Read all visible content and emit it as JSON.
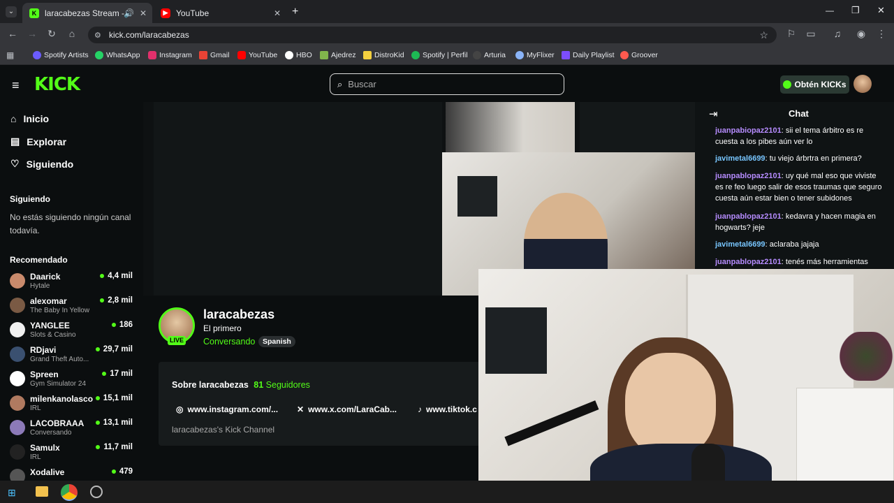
{
  "browser": {
    "tabs": [
      {
        "title": "laracabezas Stream - Watch",
        "active": true
      },
      {
        "title": "YouTube",
        "active": false
      }
    ],
    "url": "kick.com/laracabezas",
    "bookmarks": [
      "Spotify Artists",
      "WhatsApp",
      "Instagram",
      "Gmail",
      "YouTube",
      "HBO",
      "Ajedrez",
      "DistroKid",
      "Spotify | Perfil",
      "Arturia",
      "MyFlixer",
      "Daily Playlist",
      "Groover"
    ]
  },
  "kick": {
    "search_placeholder": "Buscar",
    "get_kicks": "Obtén KICKs",
    "nav": [
      "Inicio",
      "Explorar",
      "Siguiendo"
    ],
    "following_title": "Siguiendo",
    "following_empty": "No estás siguiendo ningún canal todavía.",
    "recommended_title": "Recomendado",
    "recommended": [
      {
        "name": "Daarick",
        "category": "Hytale",
        "viewers": "4,4 mil"
      },
      {
        "name": "alexomar",
        "category": "The Baby In Yellow",
        "viewers": "2,8 mil"
      },
      {
        "name": "YANGLEE",
        "category": "Slots & Casino",
        "viewers": "186"
      },
      {
        "name": "RDjavi",
        "category": "Grand Theft Auto...",
        "viewers": "29,7 mil"
      },
      {
        "name": "Spreen",
        "category": "Gym Simulator 24",
        "viewers": "17 mil"
      },
      {
        "name": "milenkanolasco",
        "category": "IRL",
        "viewers": "15,1 mil"
      },
      {
        "name": "LACOBRAAA",
        "category": "Conversando",
        "viewers": "13,1 mil"
      },
      {
        "name": "Samulx",
        "category": "IRL",
        "viewers": "11,7 mil"
      },
      {
        "name": "Xodalive",
        "category": "",
        "viewers": "479"
      }
    ],
    "channel": {
      "name": "laracabezas",
      "title": "El primero",
      "category": "Conversando",
      "language": "Spanish",
      "live": "LIVE",
      "about_label": "Sobre laracabezas",
      "followers_count": "81",
      "followers_label": "Seguidores",
      "links": [
        "www.instagram.com/...",
        "www.x.com/LaraCab...",
        "www.tiktok.c"
      ],
      "description": "laracabezas's Kick Channel"
    },
    "chat": {
      "title": "Chat",
      "messages": [
        {
          "user": "juanpabiopaz2101",
          "text": "sii el tema árbitro es re cuesta a los pibes aún ver lo"
        },
        {
          "user": "javimetal6699",
          "text": "tu viejo árbrtra en primera?"
        },
        {
          "user": "juanpablopaz2101",
          "text": "uy qué mal eso que viviste es re feo luego salir de esos traumas que seguro cuesta aún estar bien o tener subidones"
        },
        {
          "user": "juanpablopaz2101",
          "text": "kedavra y hacen magia en hogwarts? jeje"
        },
        {
          "user": "javimetal6699",
          "text": "aclaraba jajaja"
        },
        {
          "user": "juanpablopaz2101",
          "text": "tenés más herramientas"
        }
      ]
    }
  },
  "colors": {
    "kick_green": "#53fc18",
    "chat_user": "#b68cff",
    "chat_user2": "#78c6ff"
  }
}
